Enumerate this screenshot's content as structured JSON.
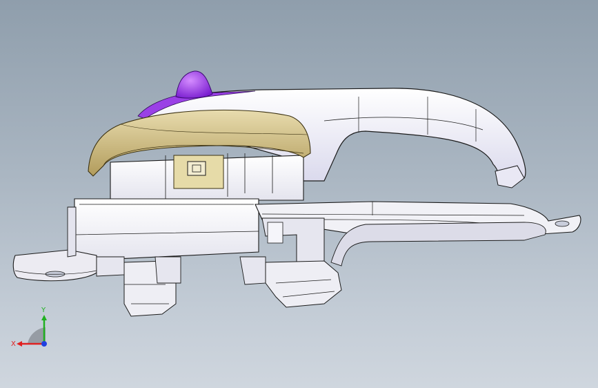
{
  "viewport": {
    "background_top": "#8f9eac",
    "background_bottom": "#cfd6de"
  },
  "model": {
    "body_color": "#f4f4f8",
    "shade_color": "#d8d8e6",
    "edge_color": "#1a1a1a",
    "knob_color": "#8b2be0",
    "ring_color": "#c8b57a",
    "label_color": "#e6dba8"
  },
  "triad": {
    "x_label": "X",
    "y_label": "Y",
    "x_color": "#e02020",
    "y_color": "#20b020",
    "z_color": "#2040e0"
  }
}
